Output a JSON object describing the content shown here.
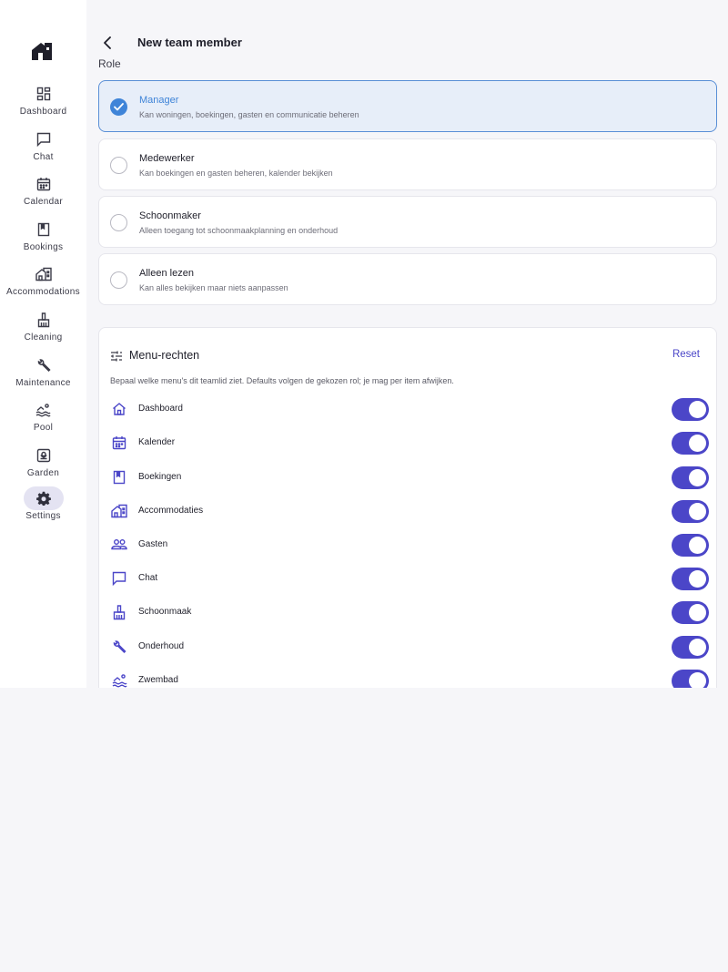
{
  "sidebar": {
    "items": [
      {
        "label": "Dashboard",
        "icon": "dashboard-icon",
        "active": false
      },
      {
        "label": "Chat",
        "icon": "chat-icon",
        "active": false
      },
      {
        "label": "Calendar",
        "icon": "calendar-icon",
        "active": false
      },
      {
        "label": "Bookings",
        "icon": "bookings-icon",
        "active": false
      },
      {
        "label": "Accommodations",
        "icon": "accommodations-icon",
        "active": false
      },
      {
        "label": "Cleaning",
        "icon": "cleaning-icon",
        "active": false
      },
      {
        "label": "Maintenance",
        "icon": "maintenance-icon",
        "active": false
      },
      {
        "label": "Pool",
        "icon": "pool-icon",
        "active": false
      },
      {
        "label": "Garden",
        "icon": "garden-icon",
        "active": false
      },
      {
        "label": "Settings",
        "icon": "settings-icon",
        "active": true
      }
    ]
  },
  "header": {
    "title": "New team member"
  },
  "role_section": {
    "label": "Role",
    "options": [
      {
        "title": "Manager",
        "description": "Kan woningen, boekingen, gasten en communicatie beheren",
        "selected": true
      },
      {
        "title": "Medewerker",
        "description": "Kan boekingen en gasten beheren, kalender bekijken",
        "selected": false
      },
      {
        "title": "Schoonmaker",
        "description": "Alleen toegang tot schoonmaakplanning en onderhoud",
        "selected": false
      },
      {
        "title": "Alleen lezen",
        "description": "Kan alles bekijken maar niets aanpassen",
        "selected": false
      }
    ]
  },
  "menu_permissions": {
    "title": "Menu-rechten",
    "reset_label": "Reset",
    "description": "Bepaal welke menu's dit teamlid ziet. Defaults volgen de gekozen rol; je mag per item afwijken.",
    "items": [
      {
        "label": "Dashboard",
        "icon": "home-icon",
        "enabled": true
      },
      {
        "label": "Kalender",
        "icon": "calendar-icon",
        "enabled": true
      },
      {
        "label": "Boekingen",
        "icon": "bookings-icon",
        "enabled": true
      },
      {
        "label": "Accommodaties",
        "icon": "accommodations-icon",
        "enabled": true
      },
      {
        "label": "Gasten",
        "icon": "guests-icon",
        "enabled": true
      },
      {
        "label": "Chat",
        "icon": "chat-icon",
        "enabled": true
      },
      {
        "label": "Schoonmaak",
        "icon": "cleaning-icon",
        "enabled": true
      },
      {
        "label": "Onderhoud",
        "icon": "maintenance-icon",
        "enabled": true
      },
      {
        "label": "Zwembad",
        "icon": "pool-icon",
        "enabled": true
      }
    ]
  },
  "colors": {
    "accent": "#4b46c8",
    "selected_blue": "#3f84d8",
    "selected_bg": "#e7eef9"
  }
}
